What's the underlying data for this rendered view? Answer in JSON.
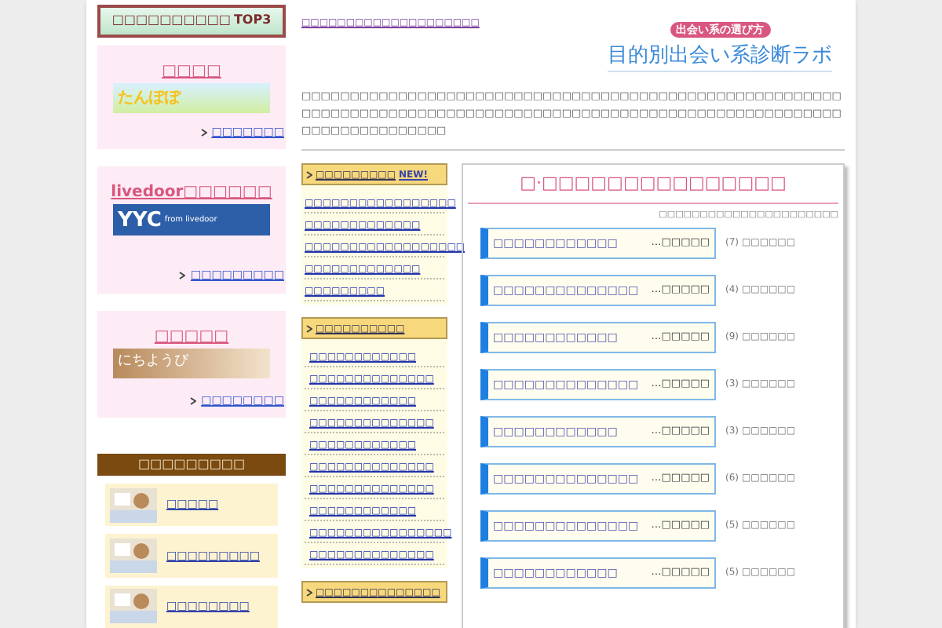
{
  "left": {
    "ranking_title": "□□□□□□□□□□",
    "ranking_badge": "TOP3",
    "cards": [
      {
        "title": "□□□□",
        "banner": "たんぽぽ",
        "kind": "tanpopo",
        "link": "□□□□□□□"
      },
      {
        "title": "livedoor□□□□□□",
        "banner": "YYC",
        "banner_sub": "from livedoor",
        "kind": "yyc",
        "link": "□□□□□□□□□"
      },
      {
        "title": "□□□□□",
        "banner": "にちようび",
        "kind": "nichiyoubi",
        "link": "□□□□□□□□"
      }
    ],
    "section_title": "□□□□□□□□□",
    "items": [
      {
        "label": "□□□□□"
      },
      {
        "label": "□□□□□□□□□"
      },
      {
        "label": "□□□□□□□□"
      }
    ]
  },
  "header": {
    "top_link": "□□□□□□□□□□□□□□□□□□□□",
    "logo_tagline": "出会い系の選び方",
    "logo_title": "目的別出会い系診断ラボ",
    "description": "□□□□□□□□□□□□□□□□□□□□□□□□□□□□□□□□□□□□□□□□□□□□□□□□□□□□□□□□□□□□□□□□□□□□□□□□□□□□□□□□□□□□□□□□□□□□□□□□□□□□□□□□□□□□□□□□□□□□□□□□□□□□□□□"
  },
  "middle": {
    "sections": [
      {
        "title": "□□□□□□□□□",
        "badge": "NEW!",
        "links": [
          "□□□□□□□□□□□□□□□□□",
          "□□□□□□□□□□□□□",
          "□□□□□□□□□□□□□□□□□□",
          "□□□□□□□□□□□□□",
          "□□□□□□□□□"
        ]
      },
      {
        "title": "□□□□□□□□□□",
        "links": [
          "□□□□□□□□□□□□",
          "□□□□□□□□□□□□□□",
          "□□□□□□□□□□□□",
          "□□□□□□□□□□□□□□",
          "□□□□□□□□□□□□",
          "□□□□□□□□□□□□□□",
          "□□□□□□□□□□□□□□",
          "□□□□□□□□□□□□",
          "□□□□□□□□□□□□□□□□",
          "□□□□□□□□□□□□□□"
        ]
      },
      {
        "title": "□□□□□□□□□□□□□□"
      }
    ]
  },
  "main": {
    "title": "□·□□□□□□□□□□□□□□□",
    "note": "□□□□□□□□□□□□□□□□□□□□□□",
    "rows": [
      {
        "label": "□□□□□□□□□□□□",
        "more": "…□□□□□",
        "count": "(7)",
        "suffix": "□□□□□□"
      },
      {
        "label": "□□□□□□□□□□□□□□",
        "more": "…□□□□□",
        "count": "(4)",
        "suffix": "□□□□□□"
      },
      {
        "label": "□□□□□□□□□□□□",
        "more": "…□□□□□",
        "count": "(9)",
        "suffix": "□□□□□□"
      },
      {
        "label": "□□□□□□□□□□□□□□",
        "more": "…□□□□□",
        "count": "(3)",
        "suffix": "□□□□□□"
      },
      {
        "label": "□□□□□□□□□□□□",
        "more": "…□□□□□",
        "count": "(3)",
        "suffix": "□□□□□□"
      },
      {
        "label": "□□□□□□□□□□□□□□",
        "more": "…□□□□□",
        "count": "(6)",
        "suffix": "□□□□□□"
      },
      {
        "label": "□□□□□□□□□□□□□□",
        "more": "…□□□□□",
        "count": "(5)",
        "suffix": "□□□□□□"
      },
      {
        "label": "□□□□□□□□□□□□",
        "more": "…□□□□□",
        "count": "(5)",
        "suffix": "□□□□□□"
      }
    ]
  }
}
